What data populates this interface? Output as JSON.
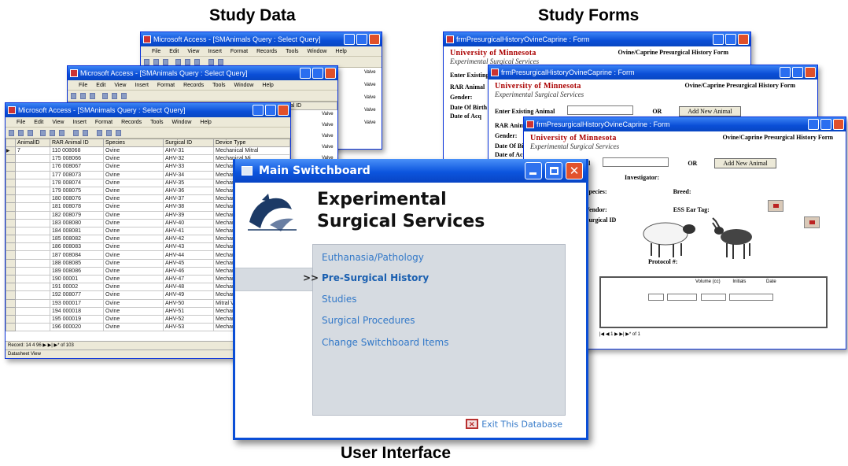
{
  "captions": {
    "study_data": "Study Data",
    "study_forms": "Study Forms",
    "user_interface": "User Interface"
  },
  "access_windows": {
    "back_title": "Microsoft Access - [SMAnimals Query : Select Query]",
    "mid_title": "Microsoft Access - [SMAnimals Query : Select Query]",
    "front_title": "Microsoft Access - [SMAnimals Query : Select Query]",
    "menu": [
      "File",
      "Edit",
      "View",
      "Insert",
      "Format",
      "Records",
      "Tools",
      "Window",
      "Help"
    ],
    "columns": [
      "AnimalID",
      "RAR Animal ID",
      "Species",
      "Surgical ID",
      "Device Type"
    ],
    "rows": [
      [
        "7",
        "110 008068",
        "Ovine",
        "AHV-31",
        "Mechanical Mitral"
      ],
      [
        "",
        "175 008066",
        "Ovine",
        "AHV-32",
        "Mechanical Mi"
      ],
      [
        "",
        "176 008067",
        "Ovine",
        "AHV-33",
        "Mechanical Mi"
      ],
      [
        "",
        "177 008073",
        "Ovine",
        "AHV-34",
        "Mechanical Mi"
      ],
      [
        "",
        "178 008074",
        "Ovine",
        "AHV-35",
        "Mechanical Mi"
      ],
      [
        "",
        "179 008075",
        "Ovine",
        "AHV-36",
        "Mechanical"
      ],
      [
        "",
        "180 008076",
        "Ovine",
        "AHV-37",
        "Mechanical Mi"
      ],
      [
        "",
        "181 008078",
        "Ovine",
        "AHV-38",
        "Mechanical Mi"
      ],
      [
        "",
        "182 008079",
        "Ovine",
        "AHV-39",
        "Mechanical Mi"
      ],
      [
        "",
        "183 008080",
        "Ovine",
        "AHV-40",
        "Mechanical Mi"
      ],
      [
        "",
        "184 008081",
        "Ovine",
        "AHV-41",
        "Mechanical Mi"
      ],
      [
        "",
        "185 008082",
        "Ovine",
        "AHV-42",
        "Mechanical"
      ],
      [
        "",
        "186 008083",
        "Ovine",
        "AHV-43",
        "Mechanical Mi"
      ],
      [
        "",
        "187 008084",
        "Ovine",
        "AHV-44",
        "Mechanical Mi"
      ],
      [
        "",
        "188 008085",
        "Ovine",
        "AHV-45",
        "Mechanical"
      ],
      [
        "",
        "189 008086",
        "Ovine",
        "AHV-46",
        "Mechanical Mi"
      ],
      [
        "",
        "190 00001",
        "Ovine",
        "AHV-47",
        "Mechanical Mi"
      ],
      [
        "",
        "191 00002",
        "Ovine",
        "AHV-48",
        "Mechanical Mi"
      ],
      [
        "",
        "192 008077",
        "Ovine",
        "AHV-49",
        "Mechanical Mi"
      ],
      [
        "",
        "193 000017",
        "Ovine",
        "AHV-50",
        "Mitral Valve"
      ],
      [
        "",
        "194 000018",
        "Ovine",
        "AHV-51",
        "Mechanical"
      ],
      [
        "",
        "195 000019",
        "Ovine",
        "AHV-52",
        "Mechanical Mi"
      ],
      [
        "",
        "196 000020",
        "Ovine",
        "AHV-53",
        "Mechanical"
      ]
    ],
    "record_nav": "Record: 14 4 96 ▶ ▶| ▶* of 103",
    "status": "Datasheet View",
    "side_values": [
      "Valve",
      "Valve",
      "Valve",
      "Valve",
      "Valve",
      "Valve",
      "Valve"
    ]
  },
  "form_windows": {
    "title_back": "frmPresurgicalHistoryOvineCaprine : Form",
    "title_mid": "frmPresurgicalHistoryOvineCaprine : Form",
    "title_front": "frmPresurgicalHistoryOvineCaprine : Form",
    "university": "University of Minnesota",
    "department": "Experimental Surgical Services",
    "form_name": "Ovine/Caprine Presurgical History Form",
    "enter_existing": "Enter Existing Animal",
    "or_label": "OR",
    "add_new": "Add New Animal",
    "rar_animal": "RAR Animal",
    "gender": "Gender:",
    "date_of_birth": "Date Of Birth",
    "date_of_acq": "Date of Acq",
    "investigator": "Investigator:",
    "species": "Species:",
    "breed": "Breed:",
    "vendor": "Vendor:",
    "ess_ear_tag": "ESS Ear Tag:",
    "surgical_id": "Surgical ID",
    "protocol": "Protocol #:",
    "col_volume": "Volume (cc)",
    "col_initials": "Initials",
    "col_date": "Date",
    "nav": "|◀ ◀ 1 ▶ ▶| ▶* of 1"
  },
  "switchboard": {
    "title": "Main Switchboard",
    "heading_line1": "Experimental",
    "heading_line2": "Surgical Services",
    "marker": ">>",
    "items": [
      "Euthanasia/Pathology",
      "Pre-Surgical History",
      "Studies",
      "Surgical Procedures",
      "Change Switchboard Items"
    ],
    "exit_label": "Exit This Database",
    "colors": {
      "accent": "#1a73c8",
      "panel": "#d8dde3",
      "titlebar": "#0a4ed6"
    }
  }
}
